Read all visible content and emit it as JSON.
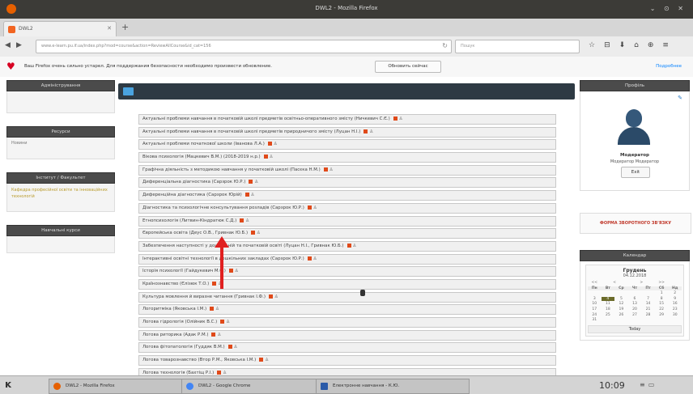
{
  "window": {
    "title": "DWL2 - Mozilla Firefox"
  },
  "tab": {
    "label": "DWL2"
  },
  "address": {
    "url": "www.e-learn.pu.if.ua/index.php?mod=course&action=ReviewAllCourse&id_cat=156",
    "search_placeholder": "Пошук"
  },
  "notice": {
    "message": "Ваш Firefox очень сильно устарел. Для поддержания безопасности необходимо произвести обновление.",
    "update_button": "Обновить сейчас",
    "more_link": "Подробнее"
  },
  "left": {
    "admin": {
      "title": "Адміністрування"
    },
    "resources": {
      "title": "Ресурси",
      "item": "Новини"
    },
    "institute": {
      "title": "Інститут / Факультет",
      "item": "Кафедра професійної освіти та інноваційних технологій"
    },
    "courses": {
      "title": "Навчальні курси"
    }
  },
  "courses": [
    "Актуальні проблеми навчання в початковій школі предметів освітньо-оперативного змісту (Ничкевич С.Є.)",
    "Актуальні проблеми навчання в початковій школі предметів природничого змісту (Луцан Н.І.)",
    "Актуальні проблеми початкової школи (Іванова Л.А.)",
    "Вікова психологія (Мацкевич В.М.) (2018-2019 н.р.)",
    "Графічна діяльність з методикою навчання у початковій школі (Пасєка Н.М.)",
    "Диференціальна діагностика (Сарзрок Ю.Р.)",
    "Диференційна діагностика (Сарзрок Юрій)",
    "Діагностика та психологічне консультування розладів (Сарзрок Ю.Р.)",
    "Етнопсихологія (Литвин-Кіндратюк С.Д.)",
    "Європейська освіта (Деус О.В., Гривнак Ю.Б.)",
    "Забезпечення наступності у дошкільній та початковій освіті (Луцан Н.І., Гривнак Ю.Б.)",
    "Інтерактивні освітні технології в дошкільних закладах (Сарзрок Ю.Р.)",
    "Історія психології (Гайдукевич М.Є.)",
    "Країнознавство (Єлізюк Т.О.)",
    "Культура мовлення й виразне читання (Гривнак І.Ф.)",
    "Логоритміка (Яковська І.М.)",
    "Логова гідрологія (Олійник В.С.)",
    "Логова риторика (Адак Р.М.)",
    "Логова фітопатологія (Гуддяк В.М.)",
    "Логова товарознавство (Втор Р.М., Яковська І.М.)",
    "Логова технологія (Бахтіщ Р.І.)"
  ],
  "profile": {
    "title": "Профіль",
    "name": "Модератор",
    "role": "Модератор Модератор",
    "exit_button": "Exit"
  },
  "feedback": {
    "label": "ФОРМА ЗВОРОТНОГО ЗВ'ЯЗКУ"
  },
  "calendar": {
    "title": "Календар",
    "month": "Грудень",
    "date": "04.12.2018",
    "nav": [
      "<<",
      "<",
      ">",
      ">>"
    ],
    "weekdays": [
      "Пн",
      "Вт",
      "Ср",
      "Чт",
      "Пт",
      "Сб",
      "Нд"
    ],
    "cells": [
      "",
      "",
      "",
      "",
      "",
      "1",
      "2",
      "3",
      "4",
      "5",
      "6",
      "7",
      "8",
      "9",
      "10",
      "11",
      "12",
      "13",
      "14",
      "15",
      "16",
      "17",
      "18",
      "19",
      "20",
      "21",
      "22",
      "23",
      "24",
      "25",
      "26",
      "27",
      "28",
      "29",
      "30",
      "31",
      "",
      "",
      "",
      "",
      "",
      ""
    ],
    "today_button": "Today"
  },
  "taskbar": {
    "items": [
      "DWL2 - Mozilla Firefox",
      "DWL2 - Google Chrome",
      "Електронне навчання - К.Ю."
    ],
    "clock": "10:09"
  }
}
